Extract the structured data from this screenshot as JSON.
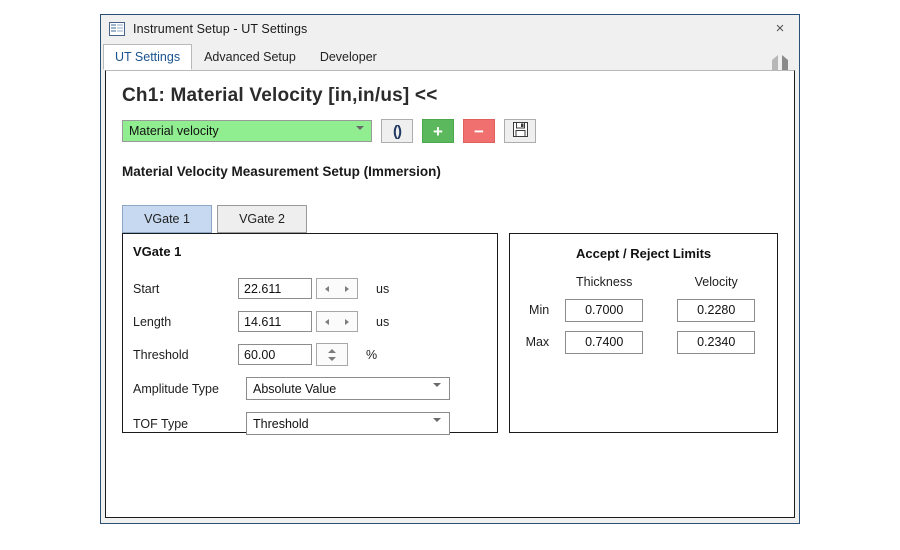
{
  "window": {
    "title": "Instrument Setup - UT Settings",
    "icon": "window-settings-icon",
    "close_label": "×"
  },
  "tabs": {
    "items": [
      {
        "label": "UT Settings",
        "active": true
      },
      {
        "label": "Advanced Setup",
        "active": false
      },
      {
        "label": "Developer",
        "active": false
      }
    ],
    "nav_prev": "tab-scroll-left-icon",
    "nav_next": "tab-scroll-right-icon"
  },
  "page": {
    "title": "Ch1: Material Velocity [in,in/us] <<",
    "section_heading": "Material Velocity Measurement Setup (Immersion)"
  },
  "toolbar": {
    "selector_value": "Material velocity",
    "selector_color": "#90ee90",
    "refresh_label": "()",
    "add_label": "+",
    "remove_label": "−",
    "save_icon": "floppy-disk-save-icon",
    "add_color": "#5cb85c",
    "remove_color": "#f07070"
  },
  "vgate_tabs": [
    {
      "label": "VGate 1",
      "active": true
    },
    {
      "label": "VGate 2",
      "active": false
    }
  ],
  "vgate_panel": {
    "title": "VGate 1",
    "fields": [
      {
        "label": "Start",
        "value": "22.611",
        "unit": "us",
        "spinner": "horizontal"
      },
      {
        "label": "Length",
        "value": "14.611",
        "unit": "us",
        "spinner": "horizontal"
      },
      {
        "label": "Threshold",
        "value": "60.00",
        "unit": "%",
        "spinner": "vertical"
      }
    ],
    "combos": [
      {
        "label": "Amplitude Type",
        "value": "Absolute Value"
      },
      {
        "label": "TOF Type",
        "value": "Threshold"
      }
    ]
  },
  "limits_panel": {
    "title": "Accept / Reject Limits",
    "columns": [
      "Thickness",
      "Velocity"
    ],
    "rows": [
      {
        "label": "Min",
        "thickness": "0.7000",
        "velocity": "0.2280"
      },
      {
        "label": "Max",
        "thickness": "0.7400",
        "velocity": "0.2340"
      }
    ]
  }
}
